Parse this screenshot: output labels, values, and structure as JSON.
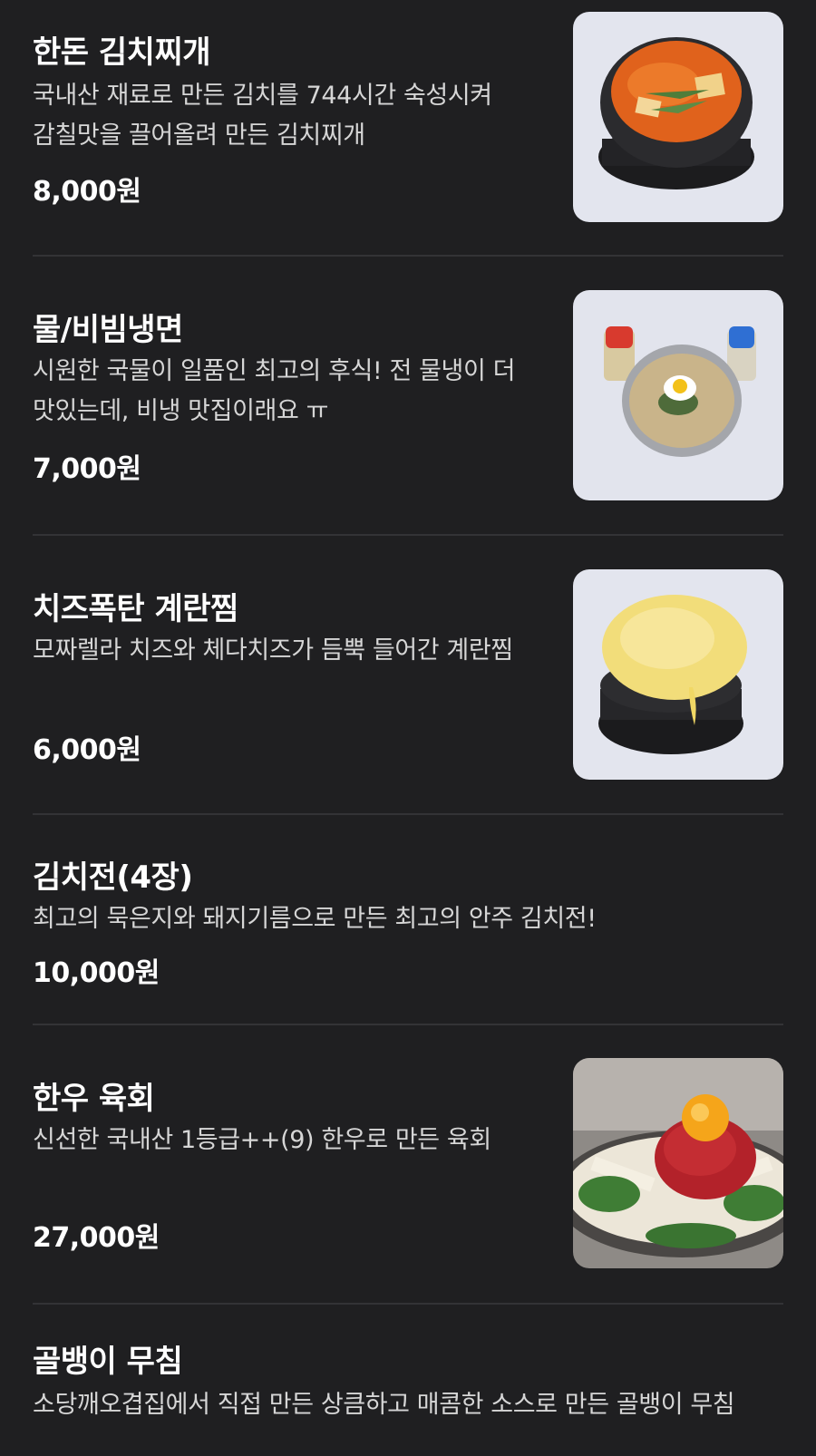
{
  "menu": [
    {
      "name": "한돈 김치찌개",
      "description": "국내산 재료로 만든 김치를 744시간 숙성시켜 감칠맛을 끌어올려 만든 김치찌개",
      "price": "8,000원",
      "image_icon": "kimchi-stew-photo"
    },
    {
      "name": "물/비빔냉면",
      "description": "시원한 국물이 일품인 최고의 후식! 전 물냉이 더 맛있는데, 비냉 맛집이래요 ㅠ",
      "price": "7,000원",
      "image_icon": "cold-noodles-photo"
    },
    {
      "name": "치즈폭탄 계란찜",
      "description": "모짜렐라 치즈와 체다치즈가 듬뿍 들어간 계란찜",
      "price": "6,000원",
      "image_icon": "cheese-egg-photo"
    },
    {
      "name": "김치전(4장)",
      "description": "최고의 묵은지와 돼지기름으로 만든 최고의 안주 김치전!",
      "price": "10,000원"
    },
    {
      "name": "한우 육회",
      "description": "신선한 국내산 1등급++(9) 한우로 만든 육회",
      "price": "27,000원",
      "image_icon": "beef-tartare-photo"
    },
    {
      "name": "골뱅이 무침",
      "description": "소당깨오겹집에서 직접 만든 상큼하고 매콤한 소스로 만든 골뱅이 무침"
    }
  ],
  "colors": {
    "background": "#1f1f21",
    "divider": "#333336",
    "text": "#ffffff",
    "description": "#d6d6d6"
  }
}
